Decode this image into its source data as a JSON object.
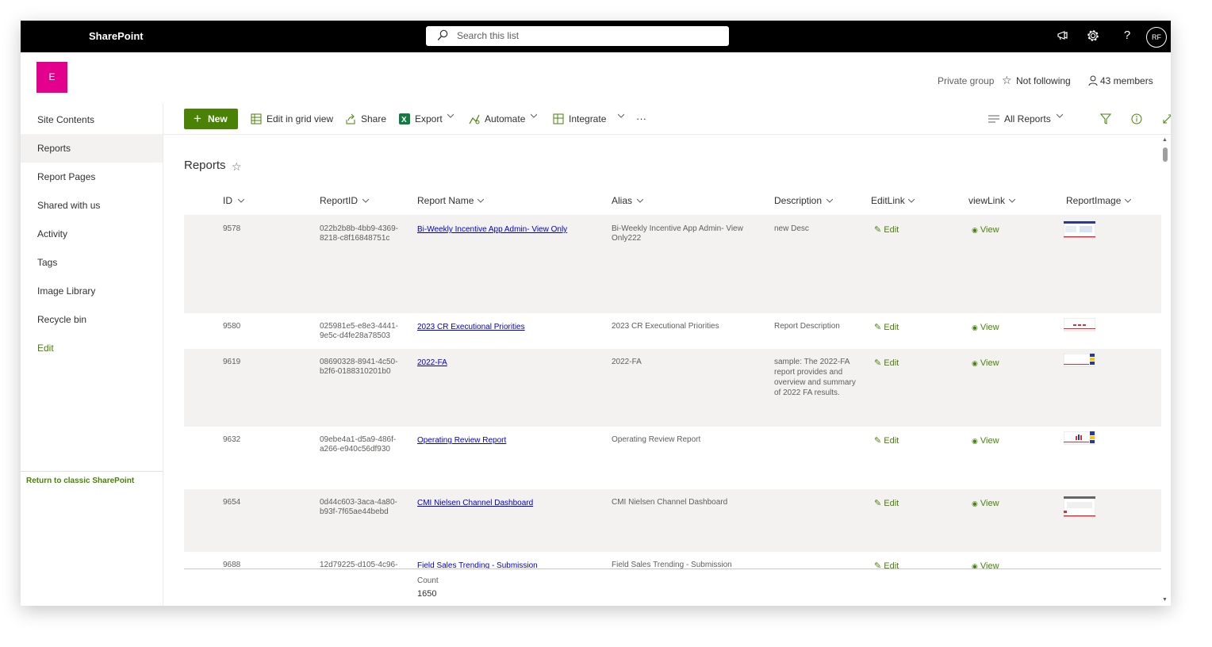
{
  "suitebar": {
    "app_name": "SharePoint",
    "search_placeholder": "Search this list",
    "avatar_initials": "RF"
  },
  "site": {
    "logo_letter": "E",
    "privacy": "Private group",
    "follow_label": "Not following",
    "members_label": "43 members"
  },
  "nav": {
    "items": [
      "Site Contents",
      "Reports",
      "Report Pages",
      "Shared with us",
      "Activity",
      "Tags",
      "Image Library",
      "Recycle bin"
    ],
    "selected": "Reports",
    "edit_label": "Edit",
    "classic_link": "Return to classic SharePoint"
  },
  "commandbar": {
    "new_label": "New",
    "edit_grid_label": "Edit in grid view",
    "share_label": "Share",
    "export_label": "Export",
    "automate_label": "Automate",
    "integrate_label": "Integrate",
    "more_label": "···",
    "view_label": "All Reports"
  },
  "list": {
    "title": "Reports",
    "columns": [
      "ID",
      "ReportID",
      "Report Name",
      "Alias",
      "Description",
      "EditLink",
      "viewLink",
      "ReportImage"
    ],
    "rows": [
      {
        "id": "9578",
        "rid1": "022b2b8b-4bb9-4369-",
        "rid2": "8218-c8f16848751c",
        "name": "Bi-Weekly Incentive App Admin- View Only",
        "alias1": "Bi-Weekly Incentive App Admin- View",
        "alias2": "Only222",
        "desc": [
          "new Desc"
        ],
        "edit": "Edit",
        "view": "View"
      },
      {
        "id": "9580",
        "rid1": "025981e5-e8e3-4441-",
        "rid2": "9e5c-d4fe28a78503",
        "name": "2023 CR Executional Priorities",
        "alias1": "2023 CR Executional Priorities",
        "alias2": "",
        "desc": [
          "Report Description"
        ],
        "edit": "Edit",
        "view": "View"
      },
      {
        "id": "9619",
        "rid1": "08690328-8941-4c50-",
        "rid2": "b2f6-0188310201b0",
        "name": "2022-FA",
        "alias1": "2022-FA",
        "alias2": "",
        "desc": [
          "sample: The 2022-FA",
          "report provides and",
          "overview and summary",
          "of 2022 FA results."
        ],
        "edit": "Edit",
        "view": "View"
      },
      {
        "id": "9632",
        "rid1": "09ebe4a1-d5a9-486f-",
        "rid2": "a266-e940c56df930",
        "name": "Operating Review Report",
        "alias1": "Operating Review Report",
        "alias2": "",
        "desc": [
          ""
        ],
        "edit": "Edit",
        "view": "View"
      },
      {
        "id": "9654",
        "rid1": "0d44c603-3aca-4a80-",
        "rid2": "b93f-7f65ae44bebd",
        "name": "CMI Nielsen Channel Dashboard",
        "alias1": "CMI Nielsen Channel Dashboard",
        "alias2": "",
        "desc": [
          ""
        ],
        "edit": "Edit",
        "view": "View"
      },
      {
        "id": "9688",
        "rid1": "12d79225-d105-4c96-",
        "rid2": "",
        "name": "Field Sales Trending - Submission",
        "alias1": "Field Sales Trending - Submission",
        "alias2": "",
        "desc": [
          ""
        ],
        "edit": "Edit",
        "view": "View"
      }
    ],
    "count_label": "Count",
    "count_value": "1650"
  },
  "colors": {
    "suitebar": "#000000",
    "accent": "#498205",
    "site_logo": "#e3008c",
    "link": "#0000cc",
    "alt_row": "#f3f2f1"
  }
}
